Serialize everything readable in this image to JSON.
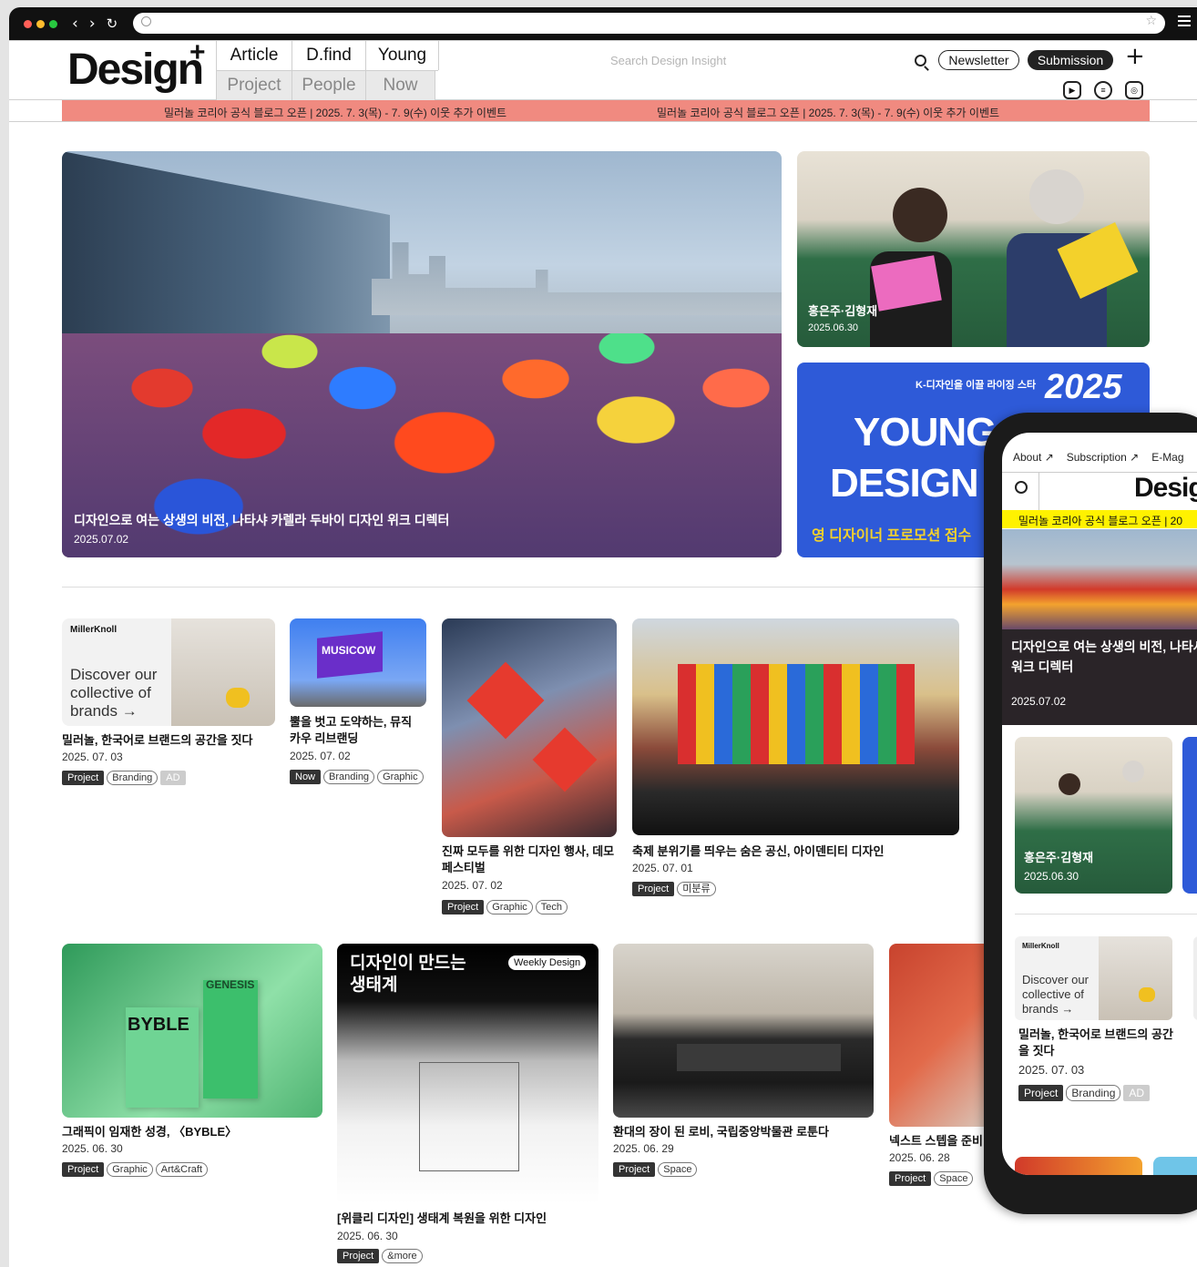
{
  "header": {
    "logo": "Design",
    "logo_plus": "+",
    "nav_top": [
      "Article",
      "D.find",
      "Young"
    ],
    "nav_bottom": [
      "Project",
      "People",
      "Now"
    ],
    "search_placeholder": "Search Design Insight",
    "newsletter": "Newsletter",
    "submission": "Submission",
    "plus": "+",
    "ticker": "밀러놀 코리아 공식 블로그 오픈 | 2025. 7. 3(목) - 7. 9(수) 이웃 추가 이벤트"
  },
  "hero": {
    "title": "디자인으로 여는 상생의 비전, 나타샤 카렐라 두바이 디자인 위크 디렉터",
    "date": "2025.07.02"
  },
  "side_card": {
    "title": "홍은주·김형재",
    "date": "2025.06.30"
  },
  "young_card": {
    "tagline": "K-디자인을 이끌 라이징 스타",
    "year": "2025",
    "word1": "YOUNG",
    "word2": "DESIGN",
    "promo": "영 디자이너 프로모션 접수"
  },
  "row1": [
    {
      "title": "밀러놀, 한국어로 브랜드의 공간을 짓다",
      "date": "2025. 07. 03",
      "tags": [
        "Project",
        "Branding",
        "AD"
      ],
      "brand": "MillerKnoll",
      "ad_text": "Discover our collective of brands →"
    },
    {
      "title": "뿔을 벗고 도약하는, 뮤직카우 리브랜딩",
      "date": "2025. 07. 02",
      "tags": [
        "Now",
        "Branding",
        "Graphic"
      ],
      "sign": "MUSICOW"
    },
    {
      "title": "진짜 모두를 위한 디자인 행사, 데모 페스티벌",
      "date": "2025. 07. 02",
      "tags": [
        "Project",
        "Graphic",
        "Tech"
      ]
    },
    {
      "title": "축제 분위기를 띄우는 숨은 공신, 아이덴티티 디자인",
      "date": "2025. 07. 01",
      "tags": [
        "Project",
        "미분류"
      ]
    }
  ],
  "row2": [
    {
      "title": "그래픽이 임재한 성경, 〈BYBLE〉",
      "date": "2025. 06. 30",
      "tags": [
        "Project",
        "Graphic",
        "Art&Craft"
      ],
      "book1": "BYBLE",
      "book2": "GENESIS"
    },
    {
      "title": "[위클리 디자인] 생태계 복원을 위한 디자인",
      "date": "2025. 06. 30",
      "tags": [
        "Project",
        "&more"
      ],
      "overlay": "디자인이 만드는 생태계",
      "badge": "Weekly Design"
    },
    {
      "title": "환대의 장이 된 로비, 국립중앙박물관 로툰다",
      "date": "2025. 06. 29",
      "tags": [
        "Project",
        "Space"
      ]
    },
    {
      "title": "넥스트 스텝을 준비",
      "date": "2025. 06. 28",
      "tags": [
        "Project",
        "Space"
      ]
    }
  ],
  "phone": {
    "top_links": [
      "About ↗",
      "Subscription ↗",
      "E-Mag"
    ],
    "logo": "Desig",
    "ticker": "밀러놀 코리아 공식 블로그 오픈 | 20",
    "hero_title": "디자인으로 여는 상생의 비전, 나타샤 워크 디렉터",
    "hero_date": "2025.07.02",
    "card_title": "홍은주·김형재",
    "card_date": "2025.06.30",
    "article_title": "밀러놀, 한국어로 브랜드의 공간을 짓다",
    "article_date": "2025. 07. 03",
    "tags": [
      "Project",
      "Branding",
      "AD"
    ],
    "brand": "MillerKnoll",
    "ad_text": "Discover our collective of brands →"
  },
  "colors": {
    "ticker_bg": "#f08a80",
    "young_bg": "#2e5ad8",
    "phone_ticker_bg": "#fff200"
  }
}
